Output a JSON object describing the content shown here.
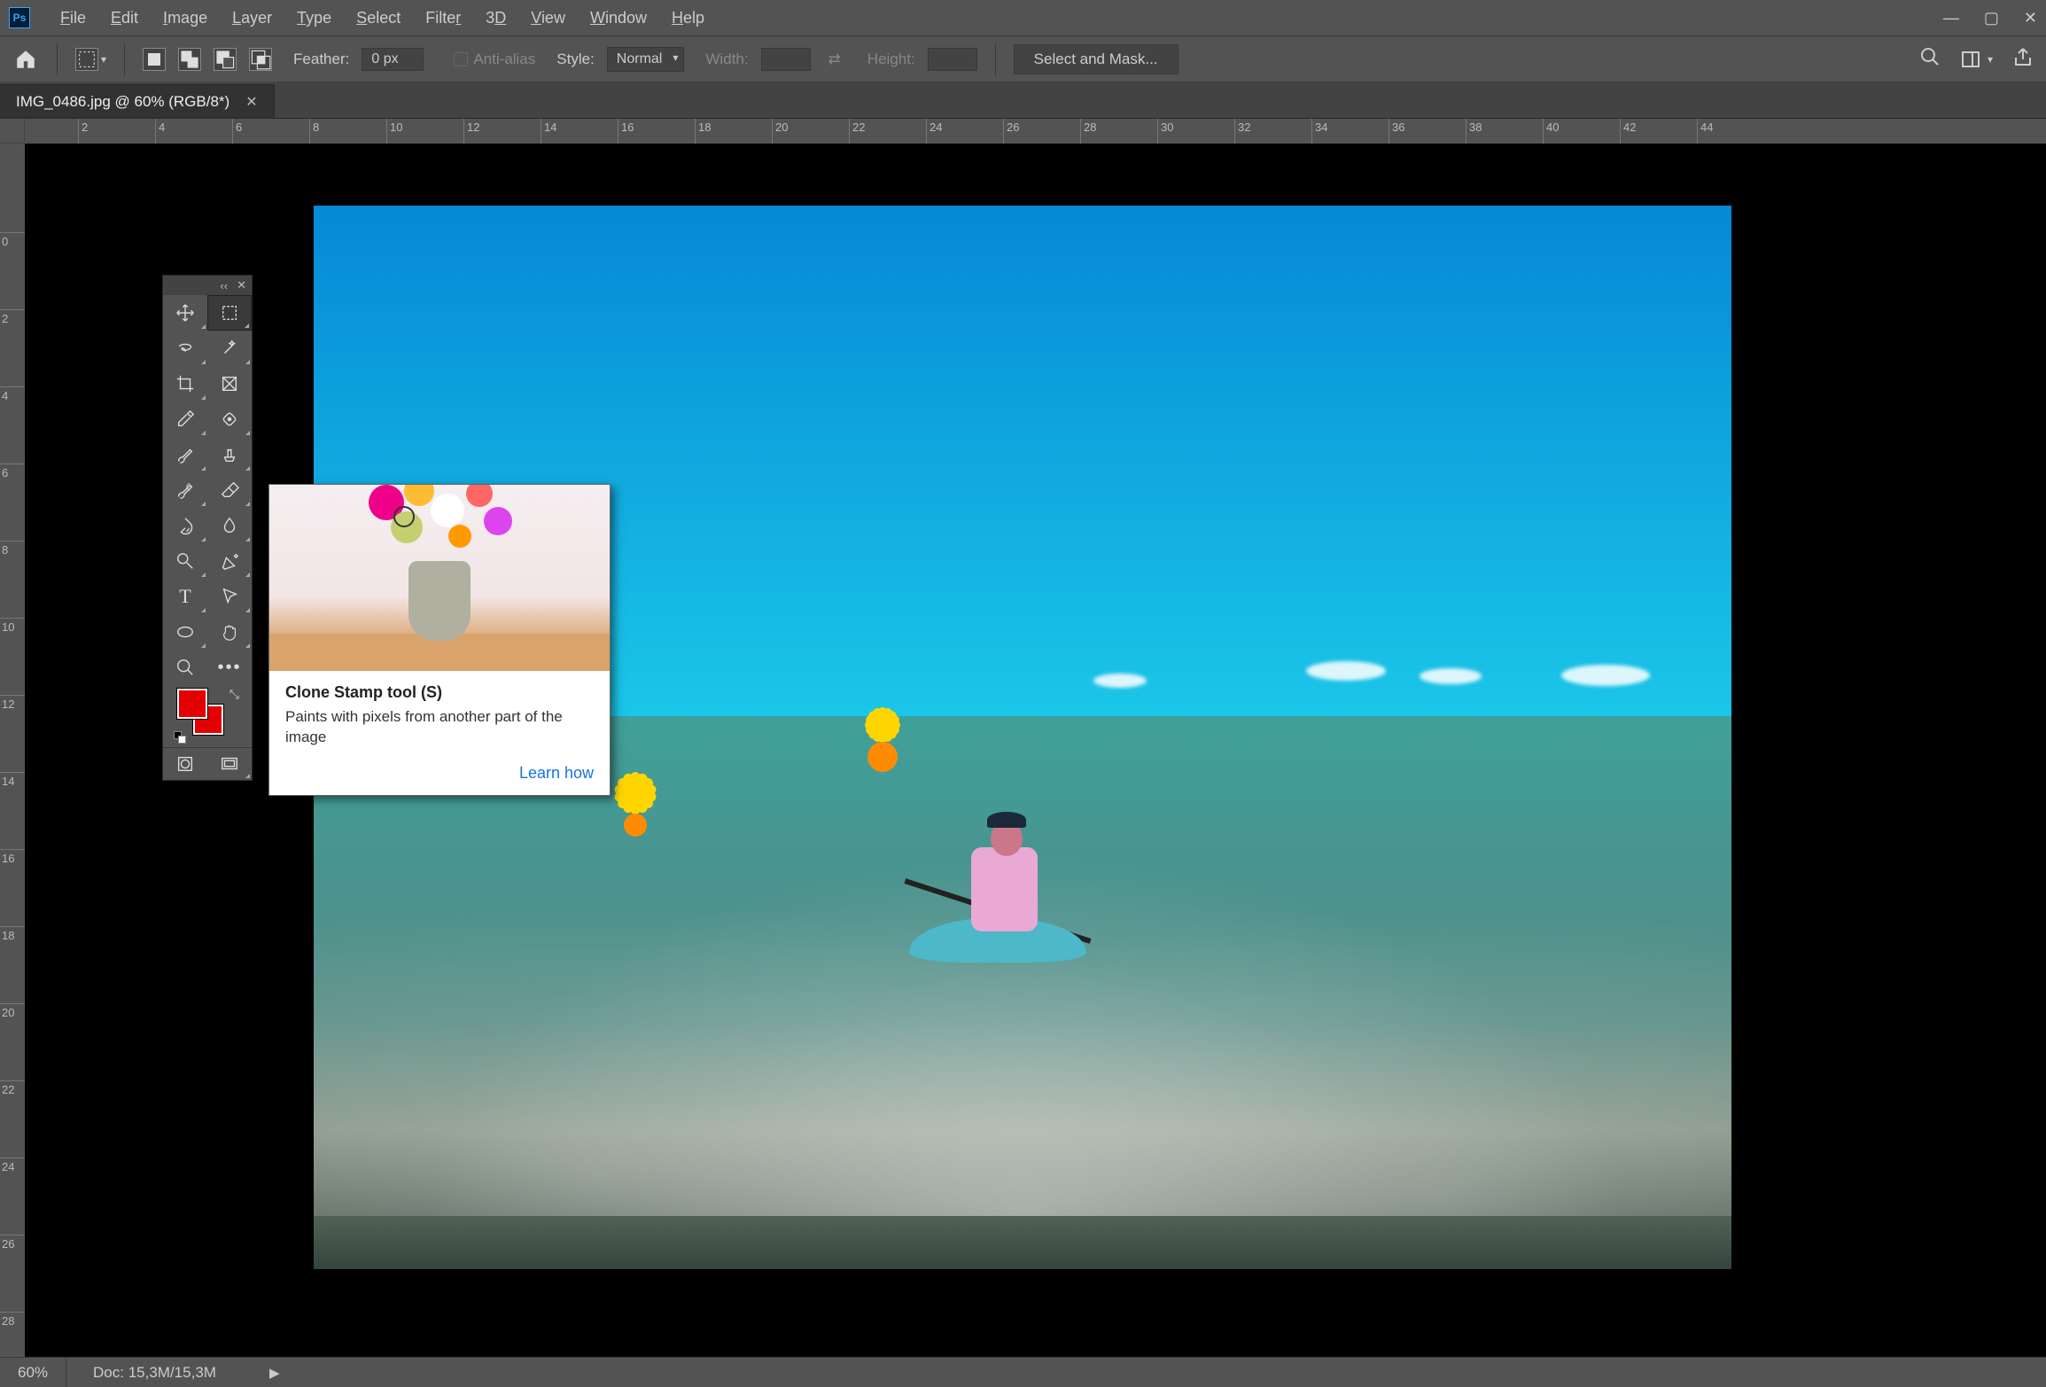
{
  "menus": [
    "File",
    "Edit",
    "Image",
    "Layer",
    "Type",
    "Select",
    "Filter",
    "3D",
    "View",
    "Window",
    "Help"
  ],
  "options": {
    "feather_label": "Feather:",
    "feather_value": "0 px",
    "antialias": "Anti-alias",
    "style_label": "Style:",
    "style_value": "Normal",
    "width_label": "Width:",
    "height_label": "Height:",
    "select_mask": "Select and Mask..."
  },
  "tab": {
    "title": "IMG_0486.jpg @ 60% (RGB/8*)"
  },
  "h_ruler": [
    "2",
    "4",
    "6",
    "8",
    "10",
    "12",
    "14",
    "16",
    "18",
    "20",
    "22",
    "24",
    "26",
    "28",
    "30",
    "32",
    "34",
    "36",
    "38",
    "40",
    "42",
    "44"
  ],
  "v_ruler": [
    "0",
    "2",
    "4",
    "6",
    "8",
    "10",
    "12",
    "14",
    "16",
    "18",
    "20",
    "22",
    "24",
    "26",
    "28"
  ],
  "tooltip": {
    "title": "Clone Stamp tool (S)",
    "desc": "Paints with pixels from another part of the image",
    "link": "Learn how"
  },
  "status": {
    "zoom": "60%",
    "doc": "Doc: 15,3M/15,3M"
  },
  "colors": {
    "fg": "#e30000",
    "bg": "#e30000"
  },
  "tool_names": [
    "move-tool",
    "rectangular-marquee-tool",
    "lasso-tool",
    "magic-wand-tool",
    "crop-tool",
    "frame-tool",
    "eyedropper-tool",
    "ruler-spot-tool",
    "brush-tool",
    "clone-stamp-tool",
    "history-brush-tool",
    "eraser-tool",
    "paint-bucket-tool",
    "blur-tool",
    "dodge-tool",
    "pen-tool",
    "type-tool",
    "path-selection-tool",
    "ellipse-shape-tool",
    "hand-tool",
    "zoom-tool",
    "more-tools"
  ]
}
